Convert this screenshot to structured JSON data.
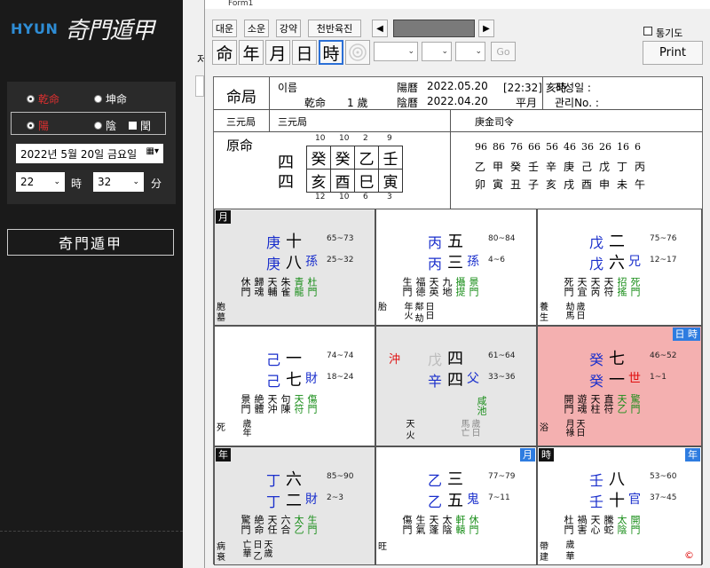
{
  "left": {
    "logo_brand": "HYUN",
    "logo_title": "奇門遁甲",
    "gender_male": "乾命",
    "gender_female": "坤命",
    "yinyang_yang": "陽",
    "yinyang_yin": "陰",
    "leap": "閏",
    "date_value": "2022년  5월 20일 금요일",
    "hour_value": "22",
    "hour_label": "時",
    "min_value": "32",
    "min_label": "分",
    "qimen_button": "奇門遁甲",
    "cut_label": "저"
  },
  "window": {
    "title": "Form1",
    "top_buttons": [
      "대운",
      "소운",
      "강약",
      "천반육진"
    ],
    "period_buttons": [
      "命",
      "年",
      "月",
      "日",
      "時"
    ],
    "go_label": "Go",
    "checkbox_label": "통기도",
    "print_label": "Print"
  },
  "sheet": {
    "title": "命局",
    "name_label": "이름",
    "gender_line": "乾命",
    "age": "1 歲",
    "solar_label": "陽曆",
    "solar_date": "2022.05.20",
    "time_text": "[22:32] 亥時",
    "lunar_label": "陰曆",
    "lunar_date": "2022.04.20",
    "month_type": "平月",
    "made_label": "작성일 :",
    "manage_label": "관리No. :",
    "sanyuan_label": "三元局",
    "sanyuan_value": "三元局",
    "siling": "庚金司令",
    "yuanming_label": "原命",
    "side_top": "四",
    "side_bottom": "四",
    "top_nums": [
      "10",
      "10",
      "2",
      "9"
    ],
    "stems": [
      "癸",
      "癸",
      "乙",
      "壬"
    ],
    "branches": [
      "亥",
      "酉",
      "巳",
      "寅"
    ],
    "bottom_nums": [
      "12",
      "10",
      "6",
      "3"
    ],
    "dayun_ages": [
      "96",
      "86",
      "76",
      "66",
      "56",
      "46",
      "36",
      "26",
      "16",
      "6"
    ],
    "dayun_stems": [
      "乙",
      "甲",
      "癸",
      "壬",
      "辛",
      "庚",
      "己",
      "戊",
      "丁",
      "丙"
    ],
    "dayun_branches": [
      "卯",
      "寅",
      "丑",
      "子",
      "亥",
      "戌",
      "酉",
      "申",
      "未",
      "午"
    ]
  },
  "palaces": [
    {
      "bg": "gray",
      "corner": "月",
      "corner_style": "dark",
      "corner_pos": "left",
      "s1": "庚",
      "n1": "十",
      "r1": "65~73",
      "s2": "庚",
      "n2": "八",
      "k2": "孫",
      "r2": "25~32",
      "row3": [
        "休門",
        "歸魂",
        "天輔",
        "朱雀",
        "青龍",
        "杜門"
      ],
      "row3c": [
        "k",
        "k",
        "k",
        "k",
        "g",
        "g"
      ],
      "foot1": "胞",
      "foot2": "墓",
      "extra": ""
    },
    {
      "bg": "white",
      "corner": "",
      "corner_style": "",
      "corner_pos": "",
      "s1": "丙",
      "n1": "五",
      "r1": "80~84",
      "s2": "丙",
      "n2": "三",
      "k2": "孫",
      "r2": "4~6",
      "row3": [
        "生門",
        "福德",
        "天英",
        "九地",
        "攝提",
        "景門"
      ],
      "row3c": [
        "k",
        "k",
        "k",
        "k",
        "g",
        "g"
      ],
      "foot1": "胎",
      "foot2": "",
      "extra": "日日鄰 劫年火"
    },
    {
      "bg": "white",
      "corner": "",
      "corner_style": "",
      "corner_pos": "",
      "s1": "戊",
      "n1": "二",
      "r1": "75~76",
      "s2": "戊",
      "n2": "六",
      "k2": "兄",
      "r2": "12~17",
      "row3": [
        "死門",
        "天宜",
        "天芮",
        "天符",
        "招搖",
        "死門"
      ],
      "row3c": [
        "k",
        "k",
        "k",
        "k",
        "g",
        "g"
      ],
      "foot1": "養",
      "foot2": "生",
      "extra": "歲日 劫馬"
    },
    {
      "bg": "white",
      "corner": "",
      "corner_style": "",
      "corner_pos": "",
      "s1": "己",
      "n1": "一",
      "r1": "74~74",
      "s2": "己",
      "n2": "七",
      "k2": "財",
      "r2": "18~24",
      "row3": [
        "景門",
        "絶體",
        "天沖",
        "句陳",
        "天符",
        "傷門"
      ],
      "row3c": [
        "k",
        "k",
        "k",
        "k",
        "g",
        "g"
      ],
      "foot1": "死",
      "foot2": "",
      "extra": "歲年"
    },
    {
      "bg": "gray",
      "corner": "",
      "corner_style": "",
      "corner_pos": "",
      "s1": "戊",
      "n1": "四",
      "r1": "61~64",
      "s2": "辛",
      "n2": "四",
      "k2": "父",
      "r2": "33~36",
      "row3": [
        "咸池"
      ],
      "row3c": [
        "g"
      ],
      "foot1": "",
      "foot2": "",
      "extra": "沖",
      "center": true
    },
    {
      "bg": "pink",
      "corner": "日 時",
      "corner_style": "blue",
      "corner_pos": "right",
      "s1": "癸",
      "n1": "七",
      "r1": "46~52",
      "s2": "癸",
      "n2": "一",
      "k2": "世",
      "r2": "1~1",
      "row3": [
        "開門",
        "遊魂",
        "天柱",
        "直符",
        "天乙",
        "驚門"
      ],
      "row3c": [
        "k",
        "k",
        "k",
        "k",
        "g",
        "g"
      ],
      "foot1": "浴",
      "foot2": "",
      "extra": "天日 月祿"
    },
    {
      "bg": "gray",
      "corner": "年",
      "corner_style": "dark",
      "corner_pos": "left",
      "s1": "丁",
      "n1": "六",
      "r1": "85~90",
      "s2": "丁",
      "n2": "二",
      "k2": "財",
      "r2": "2~3",
      "row3": [
        "驚門",
        "絶命",
        "天任",
        "六合",
        "太乙",
        "生門"
      ],
      "row3c": [
        "k",
        "k",
        "k",
        "k",
        "g",
        "g"
      ],
      "foot1": "病",
      "foot2": "衰",
      "extra": "天歲日 乙亡華"
    },
    {
      "bg": "white",
      "corner": "月",
      "corner_style": "blue",
      "corner_pos": "right",
      "s1": "乙",
      "n1": "三",
      "r1": "77~79",
      "s2": "乙",
      "n2": "五",
      "k2": "鬼",
      "r2": "7~11",
      "row3": [
        "傷門",
        "生氣",
        "天蓬",
        "太陰",
        "軒轅",
        "休門"
      ],
      "row3c": [
        "k",
        "k",
        "k",
        "k",
        "g",
        "g"
      ],
      "foot1": "旺",
      "foot2": "",
      "extra": ""
    },
    {
      "bg": "white",
      "corner": "時",
      "corner_style": "dark",
      "corner_pos": "left",
      "corner2": "年",
      "s1": "壬",
      "n1": "八",
      "r1": "53~60",
      "s2": "壬",
      "n2": "十",
      "k2": "官",
      "r2": "37~45",
      "row3": [
        "杜門",
        "禍害",
        "天心",
        "騰蛇",
        "太陰",
        "開門"
      ],
      "row3c": [
        "k",
        "k",
        "k",
        "k",
        "g",
        "g"
      ],
      "foot1": "帶",
      "foot2": "建",
      "extra": "歲 華"
    }
  ],
  "center_extra": {
    "chong": "沖",
    "top_stem": "戊",
    "bottom_foot_left": "天 火",
    "bottom_foot_right": "歲日 馬亡"
  },
  "copyright": "©"
}
